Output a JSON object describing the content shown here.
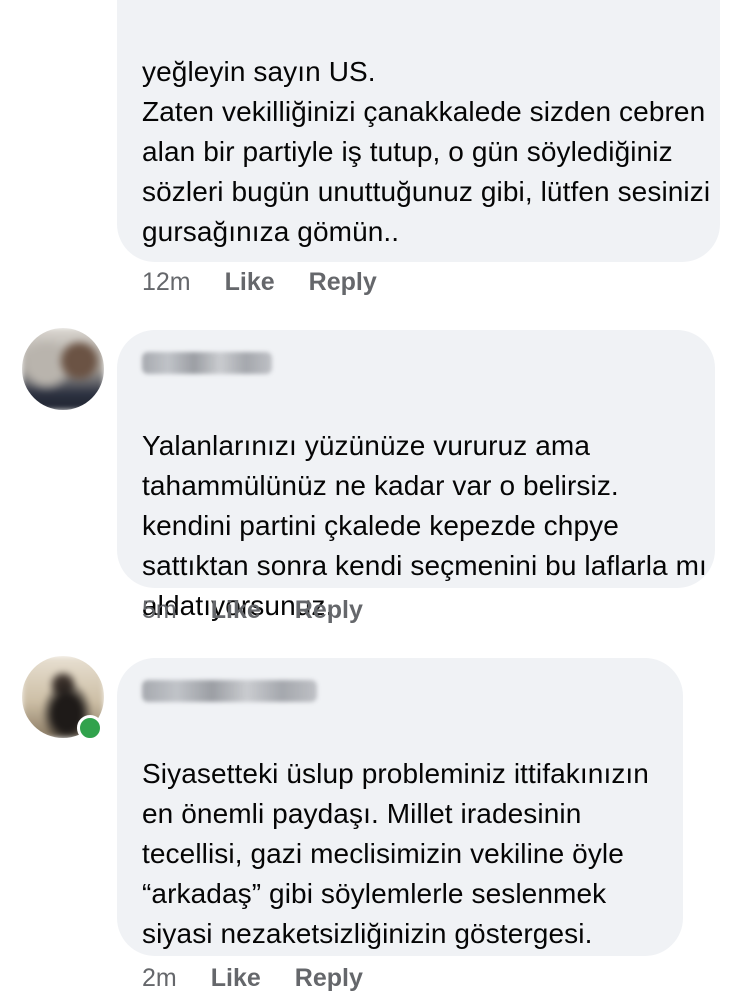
{
  "comments": [
    {
      "text": "yeğleyin sayın US.\nZaten vekilliğinizi çanakkalede sizden cebren alan bir partiyle iş tutup, o gün söylediğiniz sözleri bugün unuttuğunuz gibi, lütfen sesinizi gursağınıza gömün..",
      "time": "12m",
      "like_label": "Like",
      "reply_label": "Reply"
    },
    {
      "author_icon": "blurred-avatar",
      "text": "Yalanlarınızı yüzünüze vururuz ama tahammülünüz ne kadar var o belirsiz. kendini partini çkalede kepezde chpye sattıktan sonra kendi seçmenini bu laflarla mı aldatıyorsunuz.",
      "time": "5m",
      "like_label": "Like",
      "reply_label": "Reply"
    },
    {
      "author_icon": "blurred-avatar",
      "online": true,
      "text": "Siyasetteki üslup probleminiz ittifakınızın en önemli paydaşı. Millet iradesinin tecellisi, gazi meclisimizin vekiline öyle “arkadaş” gibi söylemlerle seslenmek siyasi nezaketsizliğinizin göstergesi.",
      "time": "2m",
      "like_label": "Like",
      "reply_label": "Reply"
    }
  ],
  "colors": {
    "bubble": "#f0f2f5",
    "meta_text": "#65676b",
    "online": "#31a24c"
  }
}
